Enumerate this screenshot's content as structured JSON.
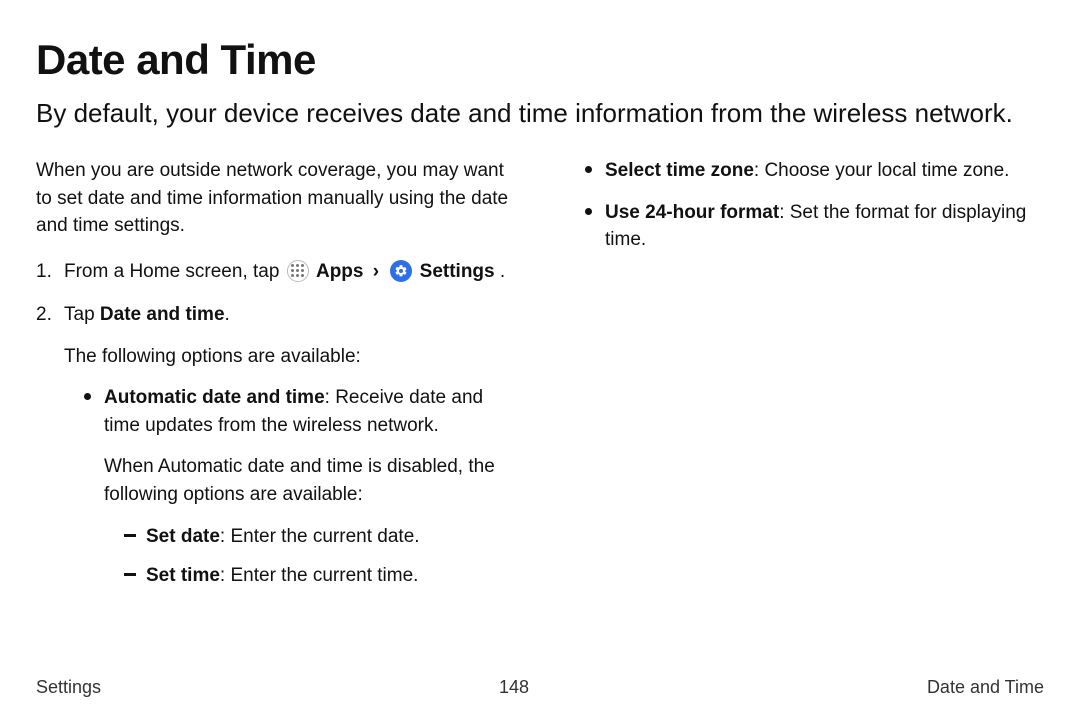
{
  "title": "Date and Time",
  "subtitle": "By default, your device receives date and time information from the wireless network.",
  "col1": {
    "intro": "When you are outside network coverage, you may want to set date and time information manually using the date and time settings.",
    "step1": {
      "prefix": "From a Home screen, tap",
      "apps_label": "Apps",
      "chevron": "›",
      "settings_label": "Settings",
      "suffix": "."
    },
    "step2": {
      "tap_prefix": "Tap ",
      "tap_bold": "Date and time",
      "tap_suffix": ".",
      "options_intro": "The following options are available:",
      "auto": {
        "label": "Automatic date and time",
        "desc": ": Receive date and time updates from the wireless network.",
        "disabled_note": "When Automatic date and time is disabled, the following options are available:",
        "set_date": {
          "label": "Set date",
          "desc": ": Enter the current date."
        },
        "set_time": {
          "label": "Set time",
          "desc": ": Enter the current time."
        }
      }
    }
  },
  "col2": {
    "select_tz": {
      "label": "Select time zone",
      "desc": ": Choose your local time zone."
    },
    "use_24h": {
      "label": "Use 24-hour format",
      "desc": ": Set the format for displaying time."
    }
  },
  "footer": {
    "left": "Settings",
    "center": "148",
    "right": "Date and Time"
  }
}
